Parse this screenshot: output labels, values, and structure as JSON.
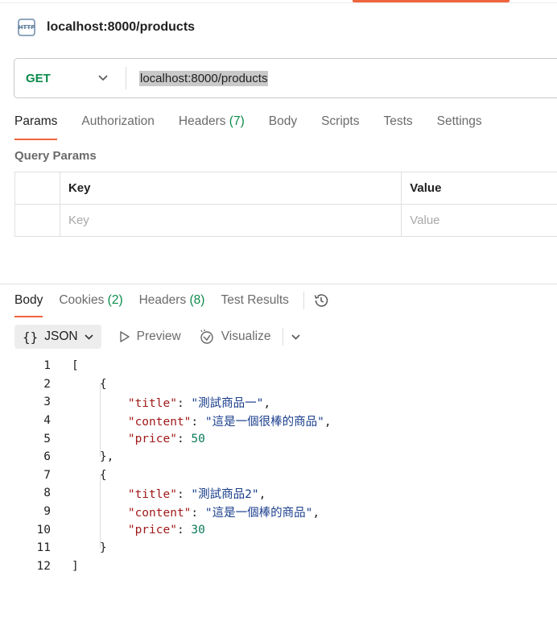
{
  "request": {
    "title": "localhost:8000/products",
    "method": "GET",
    "url": "localhost:8000/products"
  },
  "request_tabs": [
    {
      "label": "Params"
    },
    {
      "label": "Authorization"
    },
    {
      "label": "Headers",
      "count": "(7)"
    },
    {
      "label": "Body"
    },
    {
      "label": "Scripts"
    },
    {
      "label": "Tests"
    },
    {
      "label": "Settings"
    }
  ],
  "query_params": {
    "title": "Query Params",
    "headers": {
      "key": "Key",
      "value": "Value"
    },
    "placeholder": {
      "key": "Key",
      "value": "Value"
    }
  },
  "response_tabs": [
    {
      "label": "Body"
    },
    {
      "label": "Cookies",
      "count": "(2)"
    },
    {
      "label": "Headers",
      "count": "(8)"
    },
    {
      "label": "Test Results"
    }
  ],
  "format_bar": {
    "format": "JSON",
    "preview": "Preview",
    "visualize": "Visualize"
  },
  "response_body": [
    {
      "n": "1",
      "text": "["
    },
    {
      "n": "2",
      "text": "    {"
    },
    {
      "n": "3",
      "text": "        \"title\": \"測試商品一\","
    },
    {
      "n": "4",
      "text": "        \"content\": \"這是一個很棒的商品\","
    },
    {
      "n": "5",
      "text": "        \"price\": 50"
    },
    {
      "n": "6",
      "text": "    },"
    },
    {
      "n": "7",
      "text": "    {"
    },
    {
      "n": "8",
      "text": "        \"title\": \"測試商品2\","
    },
    {
      "n": "9",
      "text": "        \"content\": \"這是一個棒的商品\","
    },
    {
      "n": "10",
      "text": "        \"price\": 30"
    },
    {
      "n": "11",
      "text": "    }"
    },
    {
      "n": "12",
      "text": "]"
    }
  ],
  "colors": {
    "accent": "#f0643c",
    "method_get": "#0b8a4b",
    "json_key": "#a11a1a",
    "json_string": "#1a3e8c",
    "json_number": "#0b7a5a"
  },
  "icons": [
    "http-icon",
    "chevron-down-icon",
    "history-icon",
    "braces-icon",
    "play-icon",
    "visualize-icon"
  ]
}
